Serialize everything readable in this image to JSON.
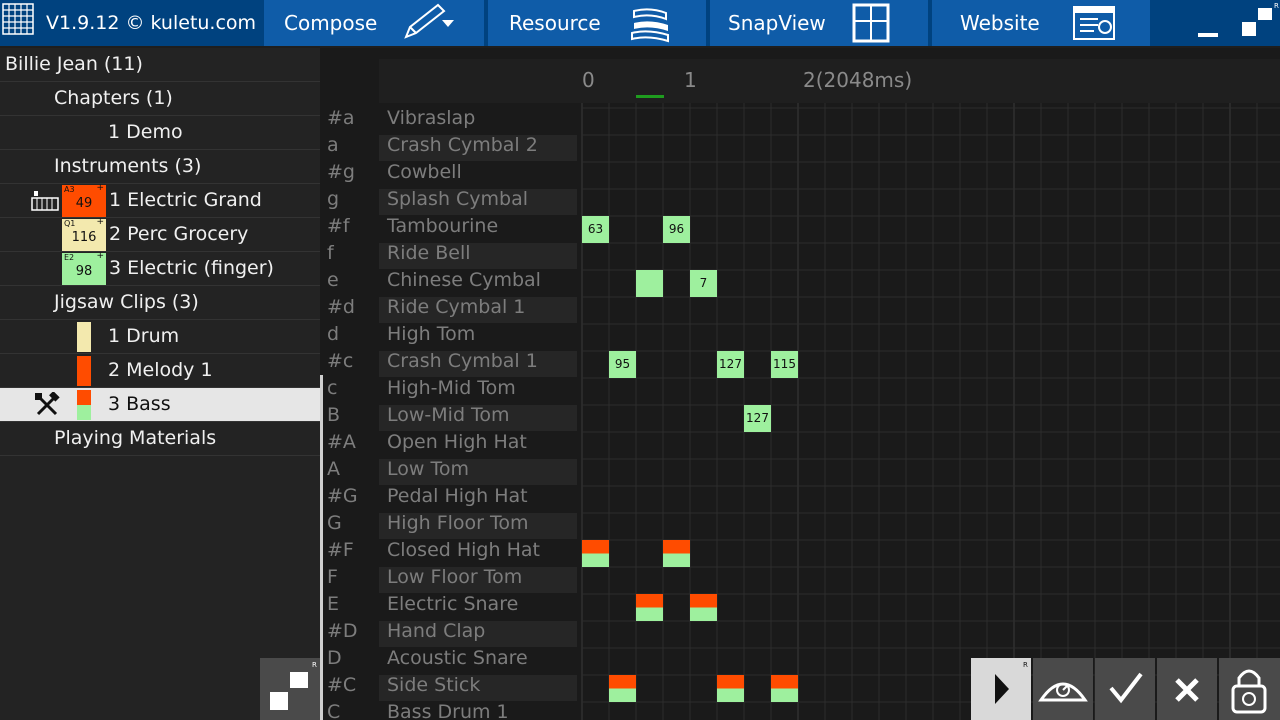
{
  "app": {
    "version": "V1.9.12 © kuletu.com",
    "menu": [
      "Compose",
      "Resource",
      "SnapView",
      "Website"
    ]
  },
  "tree": {
    "song": "Billie Jean (11)",
    "chapters": "Chapters (1)",
    "chapter_items": [
      "1 Demo"
    ],
    "instruments": "Instruments (3)",
    "instrument_items": [
      {
        "label": "1 Electric Grand",
        "value": "49",
        "corner": "A3",
        "color": "#ff4c00"
      },
      {
        "label": "2 Perc Grocery",
        "value": "116",
        "corner": "Q1",
        "color": "#f3e9ae"
      },
      {
        "label": "3 Electric (finger)",
        "value": "98",
        "corner": "E2",
        "color": "#9ef09e"
      }
    ],
    "clips": "Jigsaw Clips (3)",
    "clip_items": [
      {
        "label": "1 Drum",
        "color": "#f3e9ae"
      },
      {
        "label": "2 Melody 1",
        "color": "#ff4c00"
      },
      {
        "label": "3 Bass",
        "color": "#ff4c00",
        "color2": "#9ef09e"
      }
    ],
    "materials": "Playing Materials"
  },
  "ruler": {
    "labels": [
      "0",
      "1",
      "2(2048ms)"
    ]
  },
  "lanes": [
    {
      "key": "#a",
      "name": "Vibraslap"
    },
    {
      "key": "a",
      "name": "Crash Cymbal 2"
    },
    {
      "key": "#g",
      "name": "Cowbell"
    },
    {
      "key": "g",
      "name": "Splash Cymbal"
    },
    {
      "key": "#f",
      "name": "Tambourine"
    },
    {
      "key": "f",
      "name": "Ride Bell"
    },
    {
      "key": "e",
      "name": "Chinese Cymbal"
    },
    {
      "key": "#d",
      "name": "Ride Cymbal 1"
    },
    {
      "key": "d",
      "name": "High Tom"
    },
    {
      "key": "#c",
      "name": "Crash Cymbal 1"
    },
    {
      "key": "c",
      "name": "High-Mid Tom"
    },
    {
      "key": "B",
      "name": "Low-Mid Tom"
    },
    {
      "key": "#A",
      "name": "Open High Hat"
    },
    {
      "key": "A",
      "name": "Low Tom"
    },
    {
      "key": "#G",
      "name": "Pedal High Hat"
    },
    {
      "key": "G",
      "name": "High Floor Tom"
    },
    {
      "key": "#F",
      "name": "Closed High Hat"
    },
    {
      "key": "F",
      "name": "Low Floor Tom"
    },
    {
      "key": "E",
      "name": "Electric Snare"
    },
    {
      "key": "#D",
      "name": "Hand Clap"
    },
    {
      "key": "D",
      "name": "Acoustic Snare"
    },
    {
      "key": "#C",
      "name": "Side Stick"
    },
    {
      "key": "C",
      "name": "Bass Drum 1"
    }
  ],
  "notes": [
    {
      "lane": 4,
      "step": 0,
      "label": "63",
      "kind": "green"
    },
    {
      "lane": 4,
      "step": 3,
      "label": "96",
      "kind": "green"
    },
    {
      "lane": 6,
      "step": 2,
      "label": "",
      "kind": "green"
    },
    {
      "lane": 6,
      "step": 4,
      "label": "7",
      "kind": "green"
    },
    {
      "lane": 9,
      "step": 1,
      "label": "95",
      "kind": "green"
    },
    {
      "lane": 9,
      "step": 5,
      "label": "127",
      "kind": "green"
    },
    {
      "lane": 9,
      "step": 7,
      "label": "115",
      "kind": "green"
    },
    {
      "lane": 11,
      "step": 6,
      "label": "127",
      "kind": "green"
    },
    {
      "lane": 16,
      "step": 0,
      "label": "",
      "kind": "split"
    },
    {
      "lane": 16,
      "step": 3,
      "label": "",
      "kind": "split"
    },
    {
      "lane": 18,
      "step": 2,
      "label": "",
      "kind": "split"
    },
    {
      "lane": 18,
      "step": 4,
      "label": "",
      "kind": "split"
    },
    {
      "lane": 21,
      "step": 1,
      "label": "",
      "kind": "split"
    },
    {
      "lane": 21,
      "step": 5,
      "label": "",
      "kind": "split"
    },
    {
      "lane": 21,
      "step": 7,
      "label": "",
      "kind": "split"
    }
  ],
  "toolbar": {
    "icons": [
      "play-icon",
      "metronome-icon",
      "check-icon",
      "close-icon",
      "lock-icon"
    ]
  },
  "colors": {
    "topbar": "#00427f",
    "button": "#0f5ca8",
    "note_green": "#9ef09e",
    "note_red": "#ff4c00"
  }
}
